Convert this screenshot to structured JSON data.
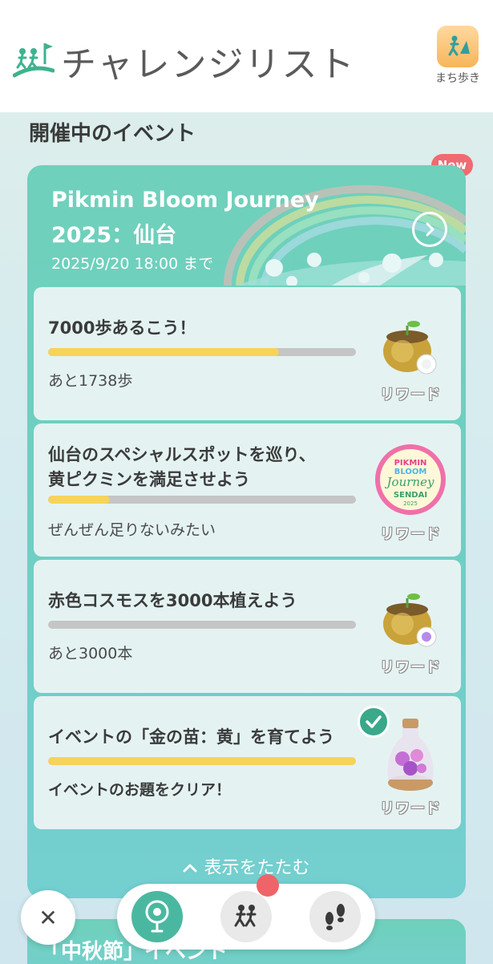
{
  "header": {
    "title": "チャレンジリスト",
    "walk_button_label": "まち歩き"
  },
  "section_title": "開催中のイベント",
  "event": {
    "badge": "New",
    "title_line1": "Pikmin Bloom Journey",
    "title_line2": "2025：仙台",
    "date": "2025/9/20 18:00 まで",
    "tasks": [
      {
        "title": "7000歩あるこう！",
        "progress": 0.75,
        "status": "あと1738歩",
        "reward_label": "リワード",
        "reward_icon": "golden-seedling-pot-icon",
        "completed": false
      },
      {
        "title_line1": "仙台のスペシャルスポットを巡り、",
        "title_line2": "黄ピクミンを満足させよう",
        "progress": 0.2,
        "status": "ぜんぜん足りないみたい",
        "reward_label": "リワード",
        "reward_icon": "pikmin-bloom-journey-sendai-badge-icon",
        "reward_badge_text": {
          "line1": "PIKMIN",
          "line2": "BLOOM",
          "line3": "Journey",
          "line4": "SENDAI",
          "line5": "2025"
        },
        "completed": false
      },
      {
        "title": "赤色コスモスを3000本植えよう",
        "progress": 0.0,
        "status": "あと3000本",
        "reward_label": "リワード",
        "reward_icon": "golden-seedling-pot-icon",
        "completed": false
      },
      {
        "title": "イベントの「金の苗：黄」を育てよう",
        "progress": 1.0,
        "status": "イベントのお題をクリア！",
        "reward_label": "リワード",
        "reward_icon": "flower-terrarium-icon",
        "completed": true
      }
    ],
    "collapse_label": "表示をたたむ"
  },
  "next_event": {
    "title": "「中秋節」イベント"
  },
  "bottom_nav": {
    "items": [
      "balloon-flower-icon",
      "walking-people-icon",
      "footprints-icon"
    ]
  },
  "colors": {
    "accent": "#6fd0bb",
    "progress_fill": "#f7d35a",
    "progress_track": "#c5c5c5",
    "badge_red": "#f06a70",
    "check_green": "#3aa88a"
  }
}
